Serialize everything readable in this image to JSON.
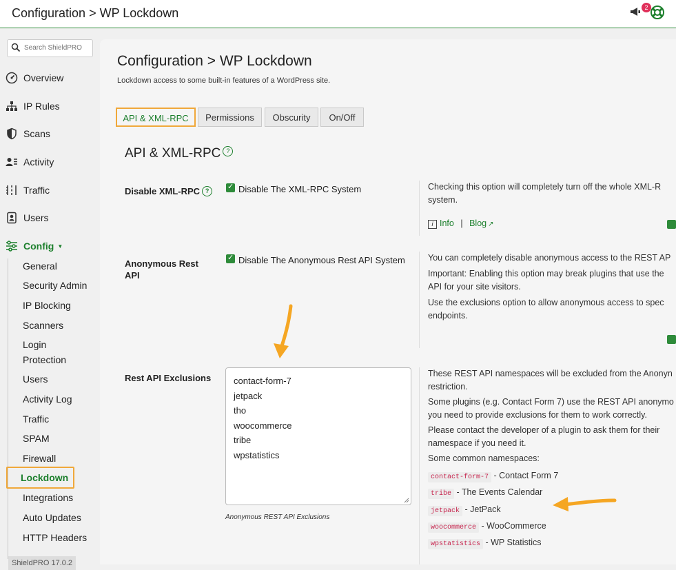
{
  "topbar": {
    "title": "Configuration > WP Lockdown",
    "notification_count": "2"
  },
  "sidebar": {
    "search_placeholder": "Search ShieldPRO",
    "nav": [
      {
        "label": "Overview",
        "icon": "speedometer-icon"
      },
      {
        "label": "IP Rules",
        "icon": "network-icon"
      },
      {
        "label": "Scans",
        "icon": "shield-icon"
      },
      {
        "label": "Activity",
        "icon": "user-list-icon"
      },
      {
        "label": "Traffic",
        "icon": "traffic-icon"
      },
      {
        "label": "Users",
        "icon": "user-badge-icon"
      },
      {
        "label": "Config",
        "icon": "sliders-icon"
      }
    ],
    "config_sub": [
      "General",
      "Security Admin",
      "IP Blocking",
      "Scanners",
      "Login",
      "Protection",
      "Users",
      "Activity Log",
      "Traffic",
      "SPAM",
      "Firewall",
      "Lockdown",
      "Integrations",
      "Auto Updates",
      "HTTP Headers"
    ],
    "version": "ShieldPRO 17.0.2"
  },
  "main": {
    "breadcrumb": "Configuration > WP Lockdown",
    "subtitle": "Lockdown access to some built-in features of a WordPress site.",
    "tabs": [
      "API & XML-RPC",
      "Permissions",
      "Obscurity",
      "On/Off"
    ],
    "section_title": "API & XML-RPC",
    "options": {
      "xmlrpc": {
        "label": "Disable XML-RPC",
        "checkbox": "Disable The XML-RPC System",
        "desc1": "Checking this option will completely turn off the whole XML-R",
        "desc2": "system.",
        "info": "Info",
        "blog": "Blog"
      },
      "rest": {
        "label1": "Anonymous Rest",
        "label2": "API",
        "checkbox": "Disable The Anonymous Rest API System",
        "desc": [
          "You can completely disable anonymous access to the REST AP",
          "Important: Enabling this option may break plugins that use the",
          "API for your site visitors.",
          "Use the exclusions option to allow anonymous access to spec",
          "endpoints."
        ]
      },
      "exclusions": {
        "label": "Rest API Exclusions",
        "values": [
          "contact-form-7",
          "jetpack",
          "tho",
          "woocommerce",
          "tribe",
          "wpstatistics"
        ],
        "caption": "Anonymous REST API Exclusions",
        "desc": [
          "These REST API namespaces will be excluded from the Anonyn",
          "restriction.",
          "Some plugins (e.g. Contact Form 7) use the REST API anonymo",
          "you need to provide exclusions for them to work correctly.",
          "Please contact the developer of a plugin to ask them for their",
          "namespace if you need it.",
          "Some common namespaces:"
        ],
        "namespaces": [
          {
            "code": "contact-form-7",
            "name": "- Contact Form 7"
          },
          {
            "code": "tribe",
            "name": "- The Events Calendar"
          },
          {
            "code": "jetpack",
            "name": "- JetPack"
          },
          {
            "code": "woocommerce",
            "name": "- WooCommerce"
          },
          {
            "code": "wpstatistics",
            "name": "- WP Statistics"
          }
        ]
      }
    }
  },
  "colors": {
    "accent": "#1c7f2c",
    "highlight": "#f0a83a",
    "arrow": "#f5a623"
  }
}
